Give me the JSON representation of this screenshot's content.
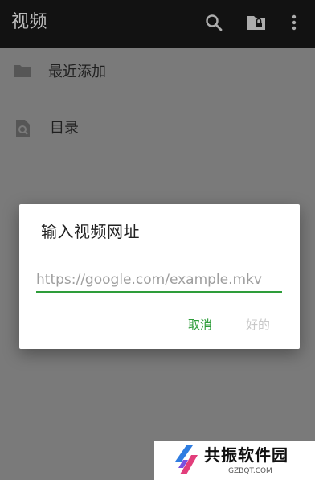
{
  "appbar": {
    "title": "视频",
    "icons": [
      "search-icon",
      "folder-lock-icon",
      "overflow-menu-icon"
    ]
  },
  "list": {
    "items": [
      {
        "label": "最近添加",
        "icon": "folder-icon"
      },
      {
        "label": "目录",
        "icon": "file-search-icon"
      }
    ]
  },
  "dialog": {
    "title": "输入视频网址",
    "input": {
      "value": "",
      "placeholder": "https://google.com/example.mkv"
    },
    "cancel_label": "取消",
    "ok_label": "好的"
  },
  "watermark": {
    "name": "共振软件园",
    "domain": "GZBQT.COM"
  },
  "colors": {
    "accent": "#2e9d3a",
    "appbar_bg": "#121212",
    "scrim_bg": "#7a7a7a",
    "disabled_text": "#c8c8c8"
  }
}
